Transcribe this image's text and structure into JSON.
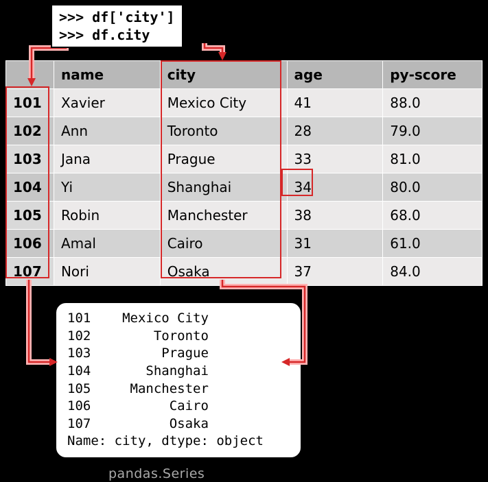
{
  "code": {
    "line1": ">>> df['city']",
    "line2": ">>> df.city"
  },
  "table": {
    "headers": [
      "",
      "name",
      "city",
      "age",
      "py-score"
    ],
    "rows": [
      {
        "idx": "101",
        "name": "Xavier",
        "city": "Mexico City",
        "age": "41",
        "py": "88.0"
      },
      {
        "idx": "102",
        "name": "Ann",
        "city": "Toronto",
        "age": "28",
        "py": "79.0"
      },
      {
        "idx": "103",
        "name": "Jana",
        "city": "Prague",
        "age": "33",
        "py": "81.0"
      },
      {
        "idx": "104",
        "name": "Yi",
        "city": "Shanghai",
        "age": "34",
        "py": "80.0"
      },
      {
        "idx": "105",
        "name": "Robin",
        "city": "Manchester",
        "age": "38",
        "py": "68.0"
      },
      {
        "idx": "106",
        "name": "Amal",
        "city": "Cairo",
        "age": "31",
        "py": "61.0"
      },
      {
        "idx": "107",
        "name": "Nori",
        "city": "Osaka",
        "age": "37",
        "py": "84.0"
      }
    ]
  },
  "series": {
    "rows": [
      {
        "idx": "101",
        "val": "Mexico City"
      },
      {
        "idx": "102",
        "val": "Toronto"
      },
      {
        "idx": "103",
        "val": "Prague"
      },
      {
        "idx": "104",
        "val": "Shanghai"
      },
      {
        "idx": "105",
        "val": "Manchester"
      },
      {
        "idx": "106",
        "val": "Cairo"
      },
      {
        "idx": "107",
        "val": "Osaka"
      }
    ],
    "footer": "Name: city, dtype: object"
  },
  "caption": "pandas.Series"
}
